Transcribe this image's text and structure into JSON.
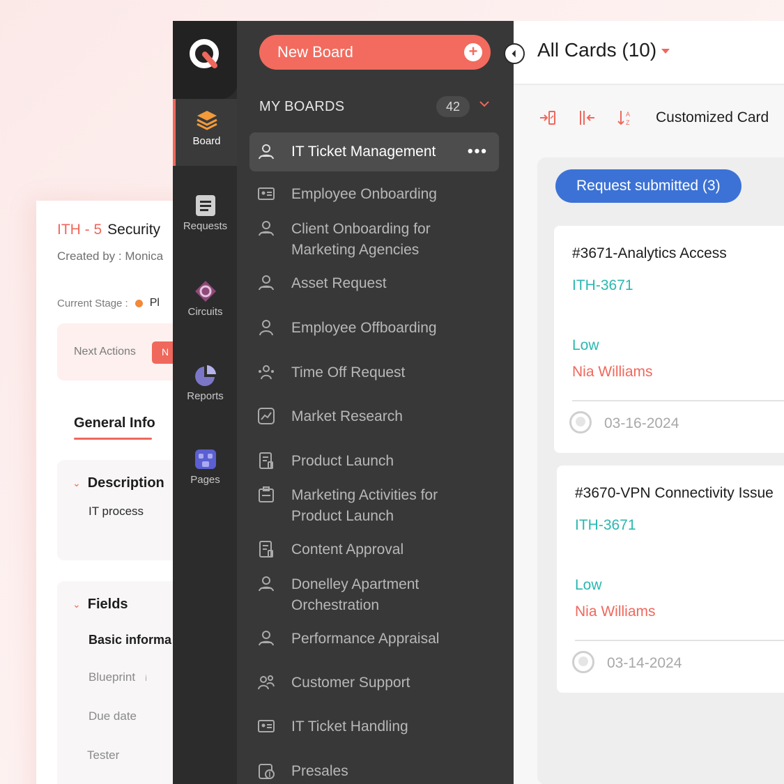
{
  "detail": {
    "ticket_id": "ITH - 5",
    "ticket_title": "Security",
    "created_by": "Created by : Monica",
    "current_stage_label": "Current Stage :",
    "current_stage_value": "Pl",
    "next_actions_label": "Next Actions",
    "next_actions_badge": "N",
    "general_info_tab": "General Info",
    "description_heading": "Description",
    "description_value": "IT process",
    "fields_heading": "Fields",
    "fields": [
      "Basic informa",
      "Blueprint",
      "Due date",
      "Tester"
    ]
  },
  "rail": {
    "items": [
      {
        "label": "Board",
        "icon": "layers-icon",
        "active": true
      },
      {
        "label": "Requests",
        "icon": "document-icon",
        "active": false
      },
      {
        "label": "Circuits",
        "icon": "circuit-icon",
        "active": false
      },
      {
        "label": "Reports",
        "icon": "pie-chart-icon",
        "active": false
      },
      {
        "label": "Pages",
        "icon": "pages-icon",
        "active": false
      }
    ]
  },
  "boards": {
    "new_board_label": "New Board",
    "my_boards_label": "MY BOARDS",
    "count": "42",
    "items": [
      {
        "label": "IT Ticket Management",
        "icon": "team-icon",
        "active": true
      },
      {
        "label": "Employee Onboarding",
        "icon": "id-card-icon"
      },
      {
        "label": "Client Onboarding for Marketing Agencies",
        "icon": "team-icon"
      },
      {
        "label": "Asset Request",
        "icon": "team-icon"
      },
      {
        "label": "Employee Offboarding",
        "icon": "person-icon"
      },
      {
        "label": "Time Off Request",
        "icon": "people-icon"
      },
      {
        "label": "Market Research",
        "icon": "chart-icon"
      },
      {
        "label": "Product Launch",
        "icon": "doc-icon"
      },
      {
        "label": "Marketing Activities for Product Launch",
        "icon": "clipboard-icon"
      },
      {
        "label": "Content Approval",
        "icon": "doc-icon"
      },
      {
        "label": "Donelley Apartment Orchestration",
        "icon": "team-icon"
      },
      {
        "label": "Performance Appraisal",
        "icon": "team-icon"
      },
      {
        "label": "Customer Support",
        "icon": "support-icon"
      },
      {
        "label": "IT Ticket Handling",
        "icon": "id-card-icon"
      },
      {
        "label": "Presales",
        "icon": "money-icon"
      }
    ]
  },
  "content": {
    "title": "All Cards (10)",
    "customized_card_label": "Customized Card",
    "stage_label": "Request submitted (3)",
    "cards": [
      {
        "title": "#3671-Analytics Access",
        "id": "ITH-3671",
        "priority": "Low",
        "assignee": "Nia Williams",
        "date": "03-16-2024"
      },
      {
        "title": "#3670-VPN Connectivity Issue",
        "id": "ITH-3671",
        "priority": "Low",
        "assignee": "Nia Williams",
        "date": "03-14-2024"
      }
    ]
  },
  "colors": {
    "accent": "#f0675c",
    "teal": "#2ab7b0",
    "blue": "#3c72d6",
    "rail_bg": "#2c2c2c",
    "panel_bg": "#383838"
  }
}
